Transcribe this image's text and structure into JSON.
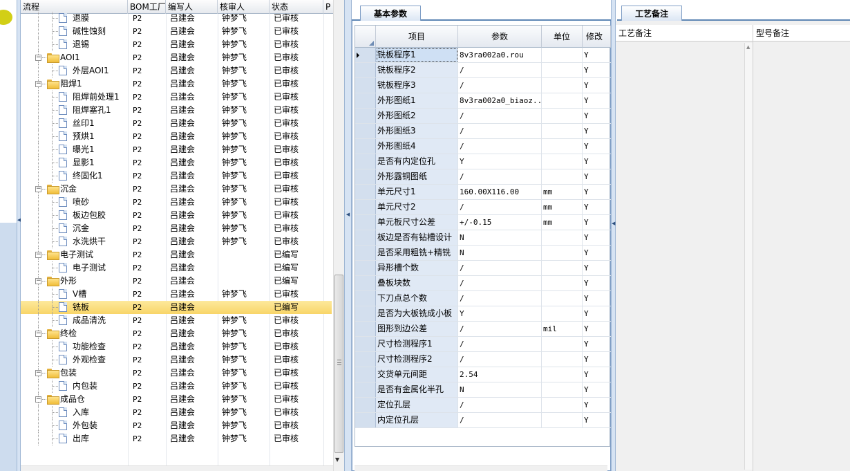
{
  "tree": {
    "columns": [
      "流程",
      "BOM工厂",
      "编写人",
      "核审人",
      "状态",
      "P"
    ],
    "rows": [
      {
        "name": "退膜",
        "level": 2,
        "type": "doc",
        "factory": "P2",
        "writer": "吕建会",
        "reviewer": "钟梦飞",
        "status": "已审核"
      },
      {
        "name": "碱性蚀刻",
        "level": 2,
        "type": "doc",
        "factory": "P2",
        "writer": "吕建会",
        "reviewer": "钟梦飞",
        "status": "已审核"
      },
      {
        "name": "退锡",
        "level": 2,
        "type": "doc",
        "factory": "P2",
        "writer": "吕建会",
        "reviewer": "钟梦飞",
        "status": "已审核"
      },
      {
        "name": "AOI1",
        "level": 1,
        "type": "folder",
        "factory": "P2",
        "writer": "吕建会",
        "reviewer": "钟梦飞",
        "status": "已审核"
      },
      {
        "name": "外层AOI1",
        "level": 2,
        "type": "doc",
        "factory": "P2",
        "writer": "吕建会",
        "reviewer": "钟梦飞",
        "status": "已审核"
      },
      {
        "name": "阻焊1",
        "level": 1,
        "type": "folder",
        "factory": "P2",
        "writer": "吕建会",
        "reviewer": "钟梦飞",
        "status": "已审核"
      },
      {
        "name": "阻焊前处理1",
        "level": 2,
        "type": "doc",
        "factory": "P2",
        "writer": "吕建会",
        "reviewer": "钟梦飞",
        "status": "已审核"
      },
      {
        "name": "阻焊塞孔1",
        "level": 2,
        "type": "doc",
        "factory": "P2",
        "writer": "吕建会",
        "reviewer": "钟梦飞",
        "status": "已审核"
      },
      {
        "name": "丝印1",
        "level": 2,
        "type": "doc",
        "factory": "P2",
        "writer": "吕建会",
        "reviewer": "钟梦飞",
        "status": "已审核"
      },
      {
        "name": "预烘1",
        "level": 2,
        "type": "doc",
        "factory": "P2",
        "writer": "吕建会",
        "reviewer": "钟梦飞",
        "status": "已审核"
      },
      {
        "name": "曝光1",
        "level": 2,
        "type": "doc",
        "factory": "P2",
        "writer": "吕建会",
        "reviewer": "钟梦飞",
        "status": "已审核"
      },
      {
        "name": "显影1",
        "level": 2,
        "type": "doc",
        "factory": "P2",
        "writer": "吕建会",
        "reviewer": "钟梦飞",
        "status": "已审核"
      },
      {
        "name": "终固化1",
        "level": 2,
        "type": "doc",
        "factory": "P2",
        "writer": "吕建会",
        "reviewer": "钟梦飞",
        "status": "已审核"
      },
      {
        "name": "沉金",
        "level": 1,
        "type": "folder",
        "factory": "P2",
        "writer": "吕建会",
        "reviewer": "钟梦飞",
        "status": "已审核"
      },
      {
        "name": "喷砂",
        "level": 2,
        "type": "doc",
        "factory": "P2",
        "writer": "吕建会",
        "reviewer": "钟梦飞",
        "status": "已审核"
      },
      {
        "name": "板边包胶",
        "level": 2,
        "type": "doc",
        "factory": "P2",
        "writer": "吕建会",
        "reviewer": "钟梦飞",
        "status": "已审核"
      },
      {
        "name": "沉金",
        "level": 2,
        "type": "doc",
        "factory": "P2",
        "writer": "吕建会",
        "reviewer": "钟梦飞",
        "status": "已审核"
      },
      {
        "name": "水洗烘干",
        "level": 2,
        "type": "doc",
        "factory": "P2",
        "writer": "吕建会",
        "reviewer": "钟梦飞",
        "status": "已审核"
      },
      {
        "name": "电子测试",
        "level": 1,
        "type": "folder",
        "factory": "P2",
        "writer": "吕建会",
        "reviewer": "",
        "status": "已编写"
      },
      {
        "name": "电子测试",
        "level": 2,
        "type": "doc",
        "factory": "P2",
        "writer": "吕建会",
        "reviewer": "",
        "status": "已编写"
      },
      {
        "name": "外形",
        "level": 1,
        "type": "folder",
        "factory": "P2",
        "writer": "吕建会",
        "reviewer": "",
        "status": "已编写"
      },
      {
        "name": "V槽",
        "level": 2,
        "type": "doc",
        "factory": "P2",
        "writer": "吕建会",
        "reviewer": "钟梦飞",
        "status": "已审核"
      },
      {
        "name": "铣板",
        "level": 2,
        "type": "doc",
        "factory": "P2",
        "writer": "吕建会",
        "reviewer": "",
        "status": "已编写",
        "selected": true
      },
      {
        "name": "成品清洗",
        "level": 2,
        "type": "doc",
        "factory": "P2",
        "writer": "吕建会",
        "reviewer": "钟梦飞",
        "status": "已审核"
      },
      {
        "name": "终检",
        "level": 1,
        "type": "folder",
        "factory": "P2",
        "writer": "吕建会",
        "reviewer": "钟梦飞",
        "status": "已审核"
      },
      {
        "name": "功能检查",
        "level": 2,
        "type": "doc",
        "factory": "P2",
        "writer": "吕建会",
        "reviewer": "钟梦飞",
        "status": "已审核"
      },
      {
        "name": "外观检查",
        "level": 2,
        "type": "doc",
        "factory": "P2",
        "writer": "吕建会",
        "reviewer": "钟梦飞",
        "status": "已审核"
      },
      {
        "name": "包装",
        "level": 1,
        "type": "folder",
        "factory": "P2",
        "writer": "吕建会",
        "reviewer": "钟梦飞",
        "status": "已审核"
      },
      {
        "name": "内包装",
        "level": 2,
        "type": "doc",
        "factory": "P2",
        "writer": "吕建会",
        "reviewer": "钟梦飞",
        "status": "已审核"
      },
      {
        "name": "成品仓",
        "level": 1,
        "type": "folder",
        "factory": "P2",
        "writer": "吕建会",
        "reviewer": "钟梦飞",
        "status": "已审核"
      },
      {
        "name": "入库",
        "level": 2,
        "type": "doc",
        "factory": "P2",
        "writer": "吕建会",
        "reviewer": "钟梦飞",
        "status": "已审核"
      },
      {
        "name": "外包装",
        "level": 2,
        "type": "doc",
        "factory": "P2",
        "writer": "吕建会",
        "reviewer": "钟梦飞",
        "status": "已审核"
      },
      {
        "name": "出库",
        "level": 2,
        "type": "doc",
        "factory": "P2",
        "writer": "吕建会",
        "reviewer": "钟梦飞",
        "status": "已审核"
      }
    ]
  },
  "params": {
    "tab": "基本参数",
    "columns": [
      "项目",
      "参数",
      "单位",
      "修改"
    ],
    "rows": [
      {
        "item": "铣板程序1",
        "value": "8v3ra002a0.rou",
        "unit": "",
        "mod": "Y",
        "current": true
      },
      {
        "item": "铣板程序2",
        "value": "/",
        "unit": "",
        "mod": "Y"
      },
      {
        "item": "铣板程序3",
        "value": "/",
        "unit": "",
        "mod": "Y"
      },
      {
        "item": "外形图纸1",
        "value": "8v3ra002a0_biaoz...",
        "unit": "",
        "mod": "Y"
      },
      {
        "item": "外形图纸2",
        "value": "/",
        "unit": "",
        "mod": "Y"
      },
      {
        "item": "外形图纸3",
        "value": "/",
        "unit": "",
        "mod": "Y"
      },
      {
        "item": "外形图纸4",
        "value": "/",
        "unit": "",
        "mod": "Y"
      },
      {
        "item": "是否有内定位孔",
        "value": "Y",
        "unit": "",
        "mod": "Y"
      },
      {
        "item": "外形露铜图纸",
        "value": "/",
        "unit": "",
        "mod": "Y"
      },
      {
        "item": "单元尺寸1",
        "value": "160.00X116.00",
        "unit": "mm",
        "mod": "Y"
      },
      {
        "item": "单元尺寸2",
        "value": "/",
        "unit": "mm",
        "mod": "Y"
      },
      {
        "item": "单元板尺寸公差",
        "value": "+/-0.15",
        "unit": "mm",
        "mod": "Y"
      },
      {
        "item": "板边是否有钻槽设计",
        "value": "N",
        "unit": "",
        "mod": "Y"
      },
      {
        "item": "是否采用粗铣+精铣",
        "value": "N",
        "unit": "",
        "mod": "Y"
      },
      {
        "item": "异形槽个数",
        "value": "/",
        "unit": "",
        "mod": "Y"
      },
      {
        "item": "叠板块数",
        "value": "/",
        "unit": "",
        "mod": "Y"
      },
      {
        "item": "下刀点总个数",
        "value": "/",
        "unit": "",
        "mod": "Y"
      },
      {
        "item": "是否为大板铣成小板",
        "value": "Y",
        "unit": "",
        "mod": "Y"
      },
      {
        "item": "图形到边公差",
        "value": "/",
        "unit": "mil",
        "mod": "Y"
      },
      {
        "item": "尺寸检测程序1",
        "value": "/",
        "unit": "",
        "mod": "Y"
      },
      {
        "item": "尺寸检测程序2",
        "value": "/",
        "unit": "",
        "mod": "Y"
      },
      {
        "item": "交货单元间距",
        "value": "2.54",
        "unit": "",
        "mod": "Y"
      },
      {
        "item": "是否有金属化半孔",
        "value": "N",
        "unit": "",
        "mod": "Y"
      },
      {
        "item": "定位孔层",
        "value": "/",
        "unit": "",
        "mod": "Y"
      },
      {
        "item": "内定位孔层",
        "value": "/",
        "unit": "",
        "mod": "Y"
      }
    ]
  },
  "notes": {
    "tab": "工艺备注",
    "process_note_label": "工艺备注",
    "model_note_label": "型号备注"
  },
  "colors": {
    "selection": "#f8d568",
    "header_bg": "#e4e9f0",
    "row_indicator": "#d3dfee",
    "accent_border": "#5d86b4"
  }
}
